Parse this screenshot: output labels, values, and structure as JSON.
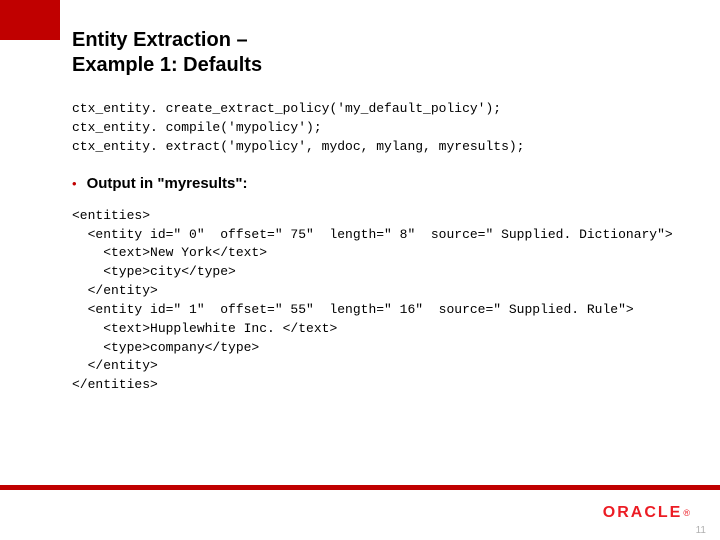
{
  "title_line1": "Entity Extraction –",
  "title_line2": "Example 1: Defaults",
  "code": {
    "l1": "ctx_entity. create_extract_policy('my_default_policy');",
    "l2": "ctx_entity. compile('mypolicy');",
    "l3": "ctx_entity. extract('mypolicy', mydoc, mylang, myresults);"
  },
  "bullet": "Output in \"myresults\":",
  "output": {
    "l1": "<entities>",
    "l2": "  <entity id=\" 0\"  offset=\" 75\"  length=\" 8\"  source=\" Supplied. Dictionary\">",
    "l3": "    <text>New York</text>",
    "l4": "    <type>city</type>",
    "l5": "  </entity>",
    "l6": "  <entity id=\" 1\"  offset=\" 55\"  length=\" 16\"  source=\" Supplied. Rule\">",
    "l7": "    <text>Hupplewhite Inc. </text>",
    "l8": "    <type>company</type>",
    "l9": "  </entity>",
    "l10": "</entities>"
  },
  "logo": "ORACLE",
  "page": "11"
}
